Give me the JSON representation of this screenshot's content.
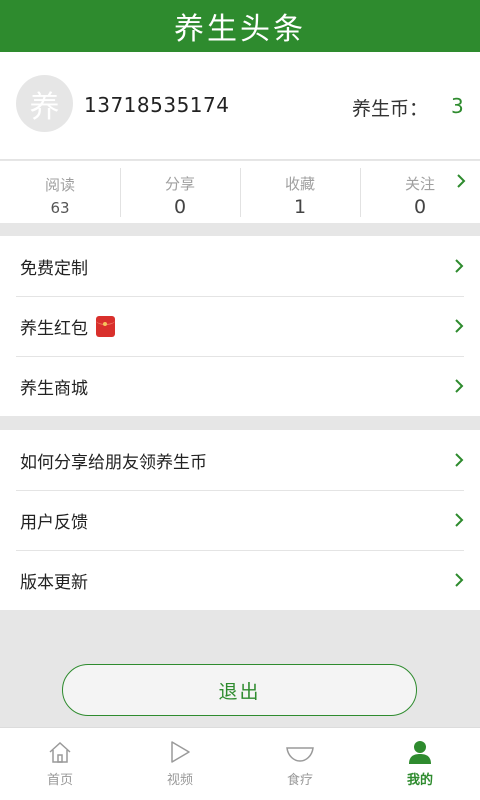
{
  "header": {
    "title": "养生头条"
  },
  "profile": {
    "avatar_char": "养",
    "phone": "13718535174",
    "coin_label": "养生币：",
    "coin_value": "3"
  },
  "stats": [
    {
      "label": "阅读",
      "value": "63"
    },
    {
      "label": "分享",
      "value": "0"
    },
    {
      "label": "收藏",
      "value": "1"
    },
    {
      "label": "关注",
      "value": "0"
    }
  ],
  "menu_group1": [
    {
      "label": "免费定制"
    },
    {
      "label": "养生红包"
    },
    {
      "label": "养生商城"
    }
  ],
  "menu_group2": [
    {
      "label": "如何分享给朋友领养生币"
    },
    {
      "label": "用户反馈"
    },
    {
      "label": "版本更新"
    }
  ],
  "logout_label": "退出",
  "tabbar": [
    {
      "label": "首页",
      "icon": "home-icon"
    },
    {
      "label": "视频",
      "icon": "play-icon"
    },
    {
      "label": "食疗",
      "icon": "bowl-icon"
    },
    {
      "label": "我的",
      "icon": "user-icon",
      "active": true
    }
  ],
  "colors": {
    "brand": "#2e8b2e",
    "background": "#e6e6e6"
  }
}
